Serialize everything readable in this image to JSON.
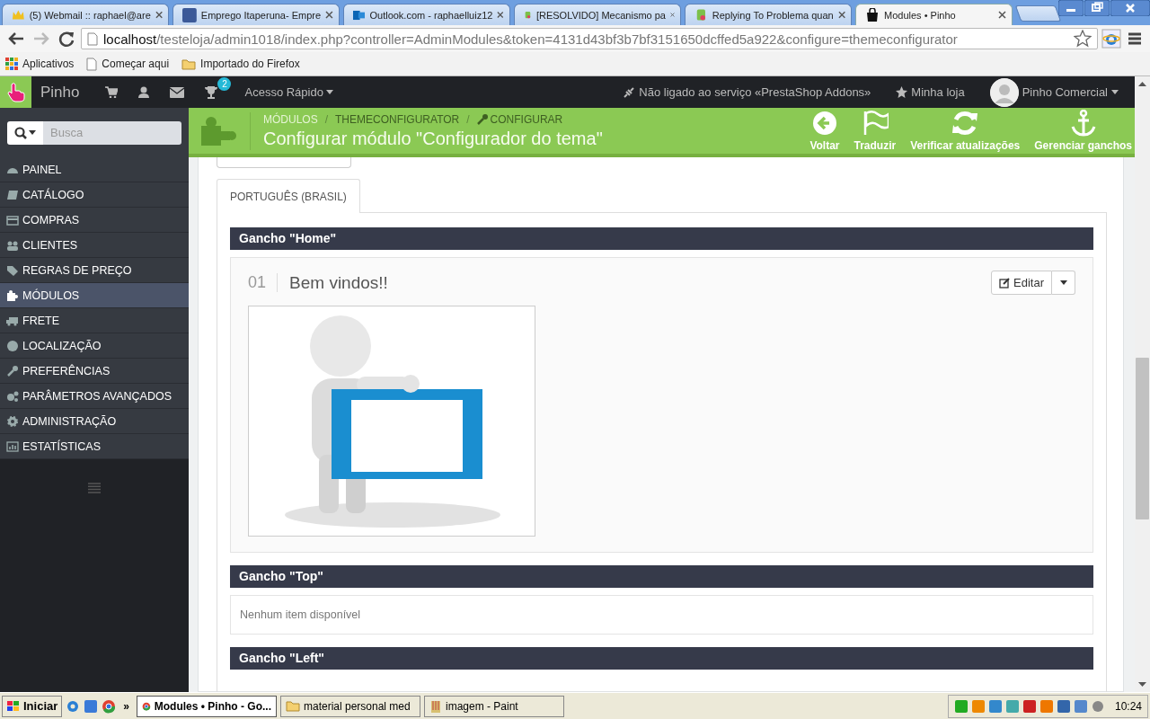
{
  "browser": {
    "tabs": [
      {
        "title": "(5) Webmail :: raphael@are",
        "selected": false
      },
      {
        "title": "Emprego Itaperuna- Empre",
        "selected": false
      },
      {
        "title": "Outlook.com - raphaelluiz12",
        "selected": false
      },
      {
        "title": "[RESOLVIDO] Mecanismo pa",
        "selected": false
      },
      {
        "title": "Replying To Problema quan",
        "selected": false
      },
      {
        "title": "Modules • Pinho",
        "selected": true
      }
    ],
    "address": {
      "host": "localhost",
      "path": "/testeloja/admin1018/index.php?controller=AdminModules&token=4131d43bf3b7bf3151650dcffed5a922&configure=themeconfigurator"
    },
    "bookmarks": [
      "Aplicativos",
      "Começar aqui",
      "Importado do Firefox"
    ]
  },
  "header": {
    "shop": "Pinho",
    "notification_count": "2",
    "quick_access": "Acesso Rápido",
    "addons_status": "Não ligado ao serviço «PrestaShop Addons»",
    "my_shop": "Minha loja",
    "user": "Pinho Comercial"
  },
  "sidebar": {
    "search_placeholder": "Busca",
    "items": [
      {
        "label": "PAINEL",
        "selected": false
      },
      {
        "label": "CATÁLOGO",
        "selected": false
      },
      {
        "label": "COMPRAS",
        "selected": false
      },
      {
        "label": "CLIENTES",
        "selected": false
      },
      {
        "label": "REGRAS DE PREÇO",
        "selected": false
      },
      {
        "label": "MÓDULOS",
        "selected": true
      },
      {
        "label": "FRETE",
        "selected": false
      },
      {
        "label": "LOCALIZAÇÃO",
        "selected": false
      },
      {
        "label": "PREFERÊNCIAS",
        "selected": false
      },
      {
        "label": "PARÂMETROS AVANÇADOS",
        "selected": false
      },
      {
        "label": "ADMINISTRAÇÃO",
        "selected": false
      },
      {
        "label": "ESTATÍSTICAS",
        "selected": false
      }
    ]
  },
  "page_header": {
    "breadcrumb": [
      "MÓDULOS",
      "THEMECONFIGURATOR",
      "CONFIGURAR"
    ],
    "breadcrumb_separators": [
      "/",
      "/"
    ],
    "title": "Configurar módulo \"Configurador do tema\"",
    "actions": [
      "Voltar",
      "Traduzir",
      "Verificar atualizações",
      "Gerenciar ganchos"
    ]
  },
  "language_tabs": [
    {
      "label": "PORTUGUÊS (BRASIL)",
      "selected": true
    }
  ],
  "hooks": [
    {
      "title": "Gancho \"Home\"",
      "items": [
        {
          "number": "01",
          "title": "Bem vindos!!",
          "edit": "Editar"
        }
      ]
    },
    {
      "title": "Gancho \"Top\"",
      "empty_text": "Nenhum item disponível"
    },
    {
      "title": "Gancho \"Left\""
    }
  ],
  "taskbar": {
    "start": "Iniciar",
    "overflow": "»",
    "windows": [
      {
        "title": "Modules • Pinho - Go...",
        "selected": true
      },
      {
        "title": "material personal med",
        "selected": false
      },
      {
        "title": "imagem - Paint",
        "selected": false
      }
    ],
    "clock": "10:24"
  }
}
